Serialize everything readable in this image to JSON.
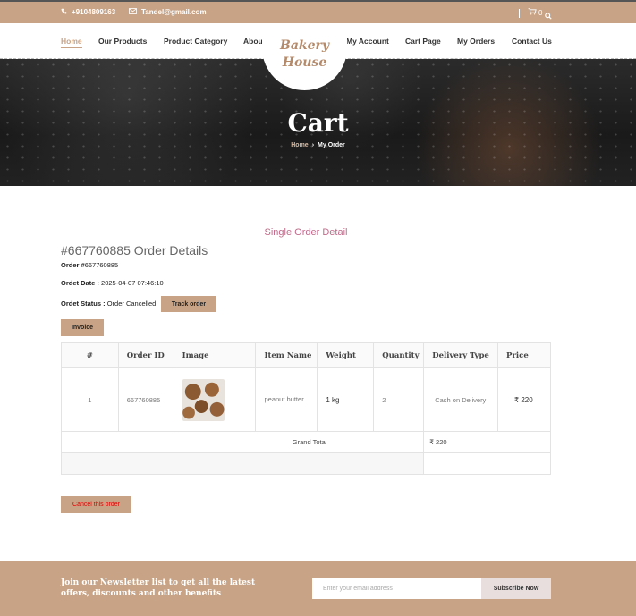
{
  "topbar": {
    "phone": "+9104809163",
    "email": "Tandel@gmail.com",
    "cart_count": "0"
  },
  "nav": {
    "items": [
      {
        "label": "Home"
      },
      {
        "label": "Our Products"
      },
      {
        "label": "Product Category"
      },
      {
        "label": "About Us"
      },
      {
        "label": "My Account"
      },
      {
        "label": "Cart Page"
      },
      {
        "label": "My Orders"
      },
      {
        "label": "Contact Us"
      }
    ],
    "logo_line1": "Bakery",
    "logo_line2": "House"
  },
  "hero": {
    "title": "Cart",
    "breadcrumb_home": "Home",
    "breadcrumb_current": "My Order"
  },
  "order": {
    "section_title": "Single Order Detail",
    "heading": "#667760885 Order Details",
    "order_label": "Order #",
    "order_number": "667760885",
    "date_label": "Ordet Date :",
    "date_value": "2025-04-07 07:46:10",
    "status_label": "Ordet Status :",
    "status_value": "Order Cancelled",
    "track_button": "Track order",
    "invoice_button": "Invoice",
    "cancel_button": "Cancel this order"
  },
  "table": {
    "headers": [
      "#",
      "Order ID",
      "Image",
      "Item Name",
      "Weight",
      "Quantity",
      "Delivery Type",
      "Price"
    ],
    "rows": [
      {
        "index": "1",
        "order_id": "667760885",
        "image": "peanut-butter-cookies",
        "item_name": "peanut butter",
        "weight": "1 kg",
        "quantity": "2",
        "delivery_type": "Cash on Delivery",
        "price": "₹ 220"
      }
    ],
    "grand_total_label": "Grand Total",
    "grand_total_value": "₹ 220"
  },
  "footer": {
    "newsletter_text": "Join our Newsletter list to get all the latest offers, discounts and other benefits",
    "email_placeholder": "Enter your email address",
    "subscribe_button": "Subscribe Now"
  },
  "colors": {
    "accent": "#c8a385",
    "section_title": "#c06a8a",
    "cancel_text": "#e00000"
  }
}
